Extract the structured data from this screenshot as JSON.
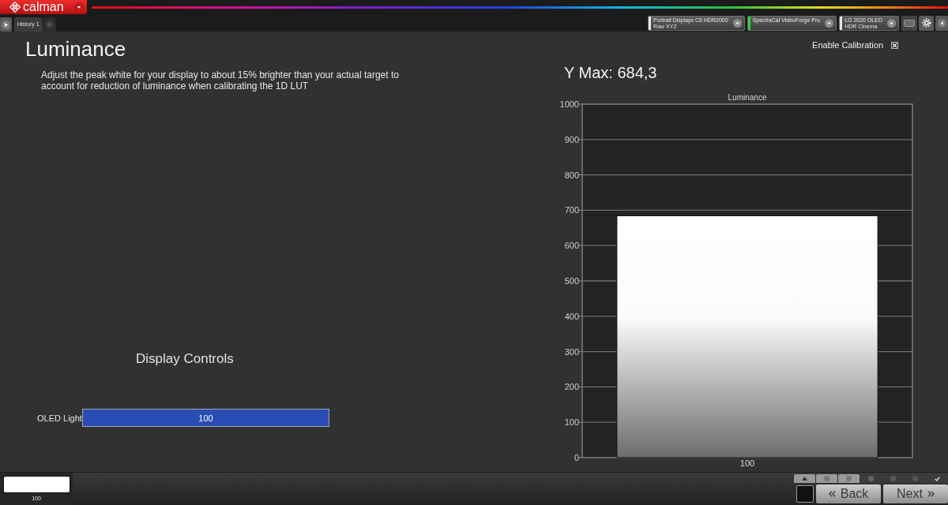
{
  "app": {
    "logo": "calman"
  },
  "tabs": [
    {
      "label": "History 1",
      "selected": true
    }
  ],
  "devices": [
    {
      "lines": [
        "Portrait Displays C6 HDR2000",
        "Raw XYZ"
      ],
      "color": "#e6e6e6"
    },
    {
      "lines": [
        "SpectraCal VideoForge Pro"
      ],
      "color": "#2fd02f"
    },
    {
      "lines": [
        "LG 2020 OLED",
        "HDR Cinema"
      ],
      "color": "#e6e6e6"
    }
  ],
  "page": {
    "title": "Luminance",
    "description": "Adjust the peak white for your display to about 15% brighter than your actual target to account for reduction of luminance when calibrating the 1D LUT"
  },
  "enable_calibration": {
    "label": "Enable Calibration",
    "checked": true
  },
  "y_max": "Y Max: 684,3",
  "chart": {
    "chart_data": {
      "type": "bar",
      "title": "Luminance",
      "categories": [
        "100"
      ],
      "values": [
        684.3
      ],
      "ylim": [
        0,
        1000
      ],
      "yticks": [
        0,
        100,
        200,
        300,
        400,
        500,
        600,
        700,
        800,
        900,
        1000
      ],
      "grid": true
    }
  },
  "display_controls": {
    "title": "Display Controls",
    "controls": [
      {
        "label": "OLED Light",
        "value": "100",
        "level": 1
      }
    ]
  },
  "patches": [
    {
      "label": "100",
      "color": "#ffffff"
    }
  ],
  "navigation": {
    "back": "Back",
    "next": "Next"
  }
}
